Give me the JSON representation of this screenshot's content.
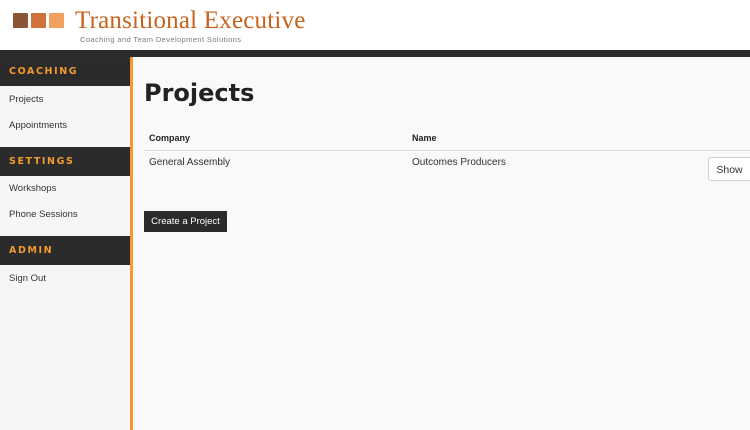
{
  "brand": {
    "title": "Transitional Executive",
    "tagline": "Coaching and Team Development Solutions",
    "square_colors": [
      "#8b5434",
      "#d0713a",
      "#f0a060"
    ],
    "accent": "#f39a2a"
  },
  "sidebar": {
    "sections": [
      {
        "heading": "COACHING",
        "items": [
          "Projects",
          "Appointments"
        ]
      },
      {
        "heading": "SETTINGS",
        "items": [
          "Workshops",
          "Phone Sessions"
        ]
      },
      {
        "heading": "ADMIN",
        "items": [
          "Sign Out"
        ]
      }
    ]
  },
  "main": {
    "title": "Projects",
    "table": {
      "headers": [
        "Company",
        "Name"
      ],
      "rows": [
        {
          "company": "General Assembly",
          "name": "Outcomes Producers",
          "action": "Show"
        }
      ]
    },
    "create_label": "Create a Project"
  }
}
